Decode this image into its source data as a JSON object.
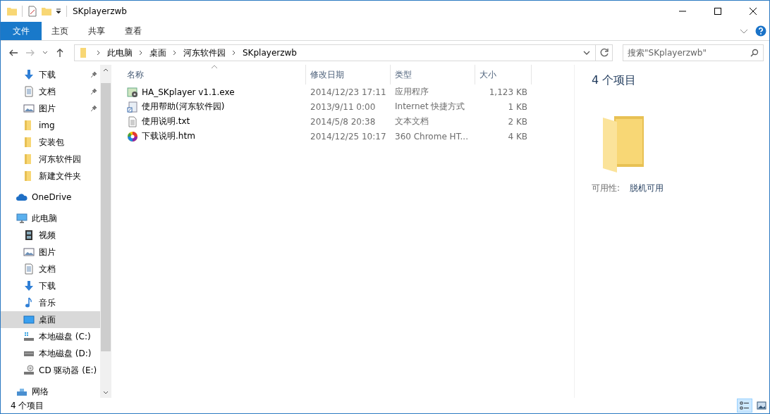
{
  "window": {
    "title": "SKplayerzwb"
  },
  "ribbon_tabs": [
    {
      "label": "文件",
      "kind": "file"
    },
    {
      "label": "主页",
      "kind": "tab"
    },
    {
      "label": "共享",
      "kind": "tab"
    },
    {
      "label": "查看",
      "kind": "tab"
    }
  ],
  "address": {
    "crumbs": [
      "此电脑",
      "桌面",
      "河东软件园",
      "SKplayerzwb"
    ]
  },
  "search": {
    "placeholder": "搜索\"SKplayerzwb\""
  },
  "sidebar": {
    "quick_access": [
      {
        "label": "下载",
        "kind": "download",
        "pinned": true,
        "selected": false
      },
      {
        "label": "文档",
        "kind": "document",
        "pinned": true,
        "selected": false
      },
      {
        "label": "图片",
        "kind": "pictures",
        "pinned": true,
        "selected": false
      },
      {
        "label": "img",
        "kind": "folder",
        "pinned": false,
        "selected": false
      },
      {
        "label": "安装包",
        "kind": "folder",
        "pinned": false,
        "selected": false
      },
      {
        "label": "河东软件园",
        "kind": "folder",
        "pinned": false,
        "selected": false
      },
      {
        "label": "新建文件夹",
        "kind": "folder",
        "pinned": false,
        "selected": false
      }
    ],
    "items": [
      {
        "label": "OneDrive",
        "kind": "cloud",
        "selected": false
      },
      {
        "label": "此电脑",
        "kind": "pc",
        "selected": false,
        "children": [
          {
            "label": "视频",
            "kind": "video",
            "selected": false
          },
          {
            "label": "图片",
            "kind": "pictures",
            "selected": false
          },
          {
            "label": "文档",
            "kind": "document",
            "selected": false
          },
          {
            "label": "下载",
            "kind": "download",
            "selected": false
          },
          {
            "label": "音乐",
            "kind": "music",
            "selected": false
          },
          {
            "label": "桌面",
            "kind": "desktop",
            "selected": true
          },
          {
            "label": "本地磁盘 (C:)",
            "kind": "system",
            "selected": false
          },
          {
            "label": "本地磁盘 (D:)",
            "kind": "drive",
            "selected": false
          },
          {
            "label": "CD 驱动器 (E:)",
            "kind": "cd",
            "selected": false
          }
        ]
      },
      {
        "label": "网络",
        "kind": "network",
        "selected": false
      }
    ]
  },
  "table": {
    "columns": [
      {
        "label": "名称",
        "sorted": true
      },
      {
        "label": "修改日期",
        "sorted": false
      },
      {
        "label": "类型",
        "sorted": false
      },
      {
        "label": "大小",
        "sorted": false
      }
    ],
    "rows": [
      {
        "name": "HA_SKplayer v1.1.exe",
        "kind": "exe",
        "date": "2014/12/23 17:11",
        "type": "应用程序",
        "size": "1,123 KB"
      },
      {
        "name": "使用帮助(河东软件园)",
        "kind": "shortcut",
        "date": "2013/9/11 0:00",
        "type": "Internet 快捷方式",
        "size": "1 KB"
      },
      {
        "name": "使用说明.txt",
        "kind": "text",
        "date": "2014/5/8 20:38",
        "type": "文本文档",
        "size": "2 KB"
      },
      {
        "name": "下载说明.htm",
        "kind": "web",
        "date": "2014/12/25 10:17",
        "type": "360 Chrome HT...",
        "size": "4 KB"
      }
    ]
  },
  "details_pane": {
    "title": "4 个项目",
    "property_label": "可用性:",
    "property_value": "脱机可用"
  },
  "status_bar": {
    "text": "4 个项目",
    "views": [
      {
        "kind": "details",
        "selected": true
      },
      {
        "kind": "large-icons",
        "selected": false
      }
    ]
  }
}
